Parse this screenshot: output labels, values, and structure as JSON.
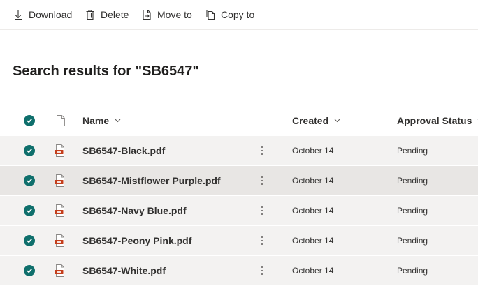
{
  "toolbar": {
    "download_label": "Download",
    "delete_label": "Delete",
    "move_label": "Move to",
    "copy_label": "Copy to"
  },
  "page": {
    "title": "Search results for \"SB6547\""
  },
  "columns": {
    "name": "Name",
    "created": "Created",
    "approval_status": "Approval Status"
  },
  "files": [
    {
      "name": "SB6547-Black.pdf",
      "created": "October 14",
      "status": "Pending",
      "selected": true
    },
    {
      "name": "SB6547-Mistflower Purple.pdf",
      "created": "October 14",
      "status": "Pending",
      "selected": true
    },
    {
      "name": "SB6547-Navy Blue.pdf",
      "created": "October 14",
      "status": "Pending",
      "selected": true
    },
    {
      "name": "SB6547-Peony Pink.pdf",
      "created": "October 14",
      "status": "Pending",
      "selected": true
    },
    {
      "name": "SB6547-White.pdf",
      "created": "October 14",
      "status": "Pending",
      "selected": true
    }
  ],
  "colors": {
    "accent": "#0f6f6c",
    "pdf_red": "#c43e1c",
    "row_bg": "#f3f2f1",
    "row_hover_bg": "#e8e6e4"
  },
  "icons": {
    "download": "download-icon",
    "delete": "trash-icon",
    "move": "move-to-icon",
    "copy": "copy-icon",
    "file": "file-type-icon",
    "pdf": "pdf-icon",
    "check": "check-circle-icon",
    "more": "more-vertical-icon",
    "sort": "chevron-down-icon"
  }
}
